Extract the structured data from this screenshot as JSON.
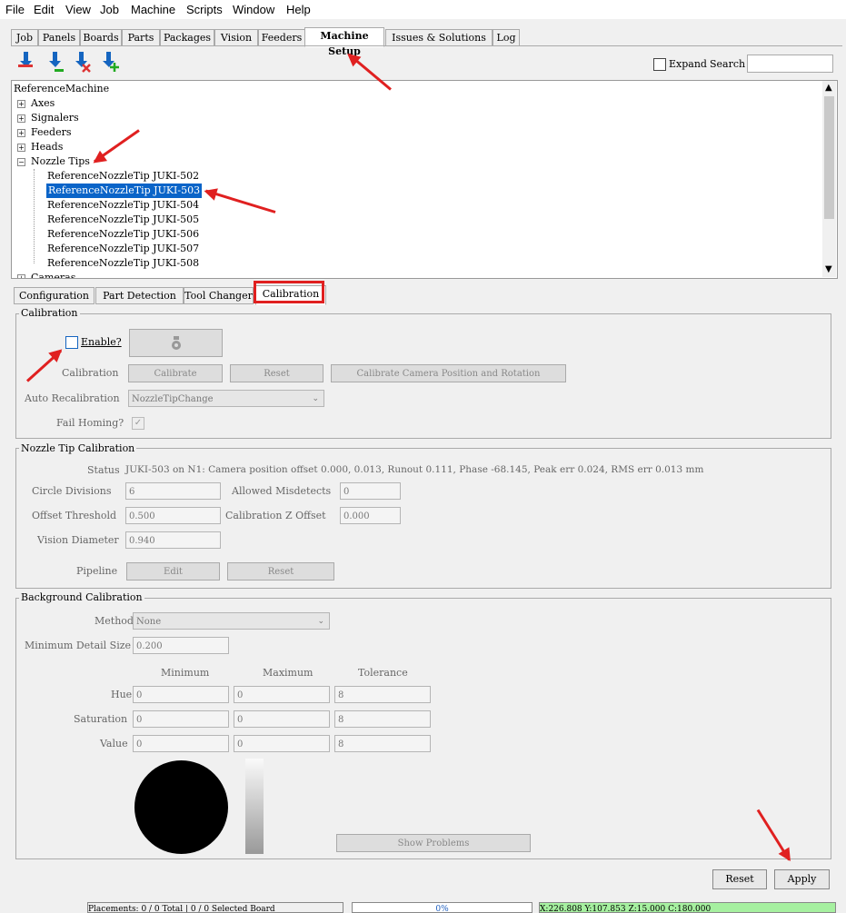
{
  "menu": [
    "File",
    "Edit",
    "View",
    "Job",
    "Machine",
    "Scripts",
    "Window",
    "Help"
  ],
  "main_tabs": [
    "Job",
    "Panels",
    "Boards",
    "Parts",
    "Packages",
    "Vision",
    "Feeders",
    "Machine Setup",
    "Issues & Solutions",
    "Log"
  ],
  "selected_main_tab": "Machine Setup",
  "toolbar": {
    "expand_label": "Expand",
    "search_label": "Search",
    "search_value": ""
  },
  "tree": {
    "root": "ReferenceMachine",
    "nodes": [
      "Axes",
      "Signalers",
      "Feeders",
      "Heads",
      "Nozzle Tips"
    ],
    "nozzle_tips": [
      "ReferenceNozzleTip JUKI-502",
      "ReferenceNozzleTip JUKI-503",
      "ReferenceNozzleTip JUKI-504",
      "ReferenceNozzleTip JUKI-505",
      "ReferenceNozzleTip JUKI-506",
      "ReferenceNozzleTip JUKI-507",
      "ReferenceNozzleTip JUKI-508"
    ],
    "next_node": "Cameras",
    "selected": "ReferenceNozzleTip JUKI-503"
  },
  "sub_tabs": [
    "Configuration",
    "Part Detection",
    "Tool Changer",
    "Calibration"
  ],
  "selected_sub_tab": "Calibration",
  "calibration": {
    "title": "Calibration",
    "enable_label": "Enable?",
    "enable_checked": false,
    "calibration_label": "Calibration",
    "calibrate_button": "Calibrate",
    "reset_button": "Reset",
    "calibrate_camera_button": "Calibrate Camera Position and Rotation",
    "auto_recal_label": "Auto Recalibration",
    "auto_recal_value": "NozzleTipChange",
    "fail_homing_label": "Fail Homing?",
    "fail_homing_checked": true
  },
  "nozzle_cal": {
    "title": "Nozzle Tip Calibration",
    "status_label": "Status",
    "status_value": "JUKI-503 on N1: Camera position offset 0.000, 0.013, Runout 0.111, Phase -68.145, Peak err 0.024, RMS err 0.013 mm",
    "circle_divisions_label": "Circle Divisions",
    "circle_divisions": "6",
    "allowed_misdetects_label": "Allowed Misdetects",
    "allowed_misdetects": "0",
    "offset_threshold_label": "Offset Threshold",
    "offset_threshold": "0.500",
    "cal_z_offset_label": "Calibration Z Offset",
    "cal_z_offset": "0.000",
    "vision_diameter_label": "Vision Diameter",
    "vision_diameter": "0.940",
    "pipeline_label": "Pipeline",
    "edit_button": "Edit",
    "reset_button": "Reset"
  },
  "bg_cal": {
    "title": "Background Calibration",
    "method_label": "Method",
    "method_value": "None",
    "min_detail_label": "Minimum Detail Size",
    "min_detail_value": "0.200",
    "col_min": "Minimum",
    "col_max": "Maximum",
    "col_tol": "Tolerance",
    "rows": [
      {
        "label": "Hue",
        "min": "0",
        "max": "0",
        "tol": "8"
      },
      {
        "label": "Saturation",
        "min": "0",
        "max": "0",
        "tol": "8"
      },
      {
        "label": "Value",
        "min": "0",
        "max": "0",
        "tol": "8"
      }
    ],
    "show_problems_button": "Show Problems"
  },
  "footer": {
    "reset_button": "Reset",
    "apply_button": "Apply"
  },
  "status": {
    "placements": "Placements: 0 / 0 Total | 0 / 0 Selected Board",
    "progress": "0%",
    "coords": "X:226.808    Y:107.853    Z:15.000    C:180.000"
  },
  "colors": {
    "selection": "#0a64c8",
    "accent_red": "#e02020",
    "status_green": "#a6f0a0"
  }
}
